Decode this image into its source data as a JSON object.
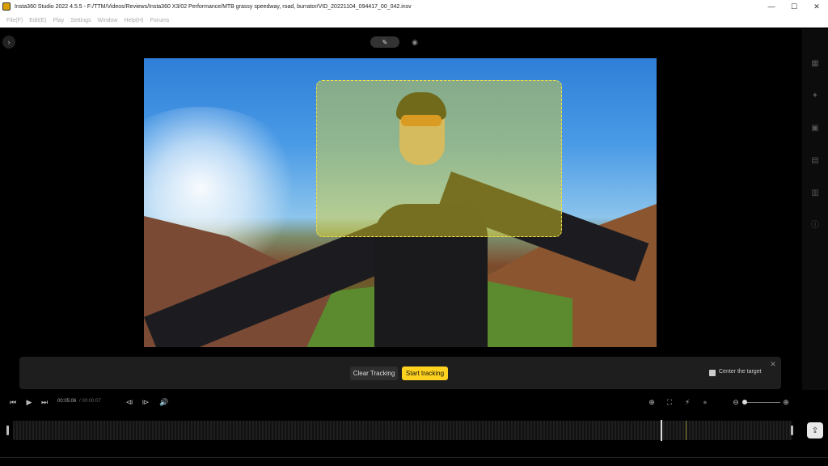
{
  "window": {
    "title": "Insta360 Studio 2022 4.5.5 - F:/TTM/Videos/Reviews/Insta360 X3/02 Performance/MTB grassy speedway, road, burrator/VID_20221104_094417_00_042.insv",
    "minimize": "—",
    "maximize": "☐",
    "close": "✕"
  },
  "menu": [
    "File(F)",
    "Edit(E)",
    "Play",
    "Settings",
    "Window",
    "Help(H)",
    "Forums"
  ],
  "viewer": {
    "expand_icon": "›",
    "edit_icon": "✎",
    "eye_icon": "◉"
  },
  "tracking": {
    "clear_label": "Clear Tracking",
    "start_label": "Start tracking",
    "center_label": "Center the target",
    "center_checked": false,
    "close_icon": "✕"
  },
  "playback": {
    "current_time": "00:05:06",
    "total_time": "/ 00:00:07",
    "prev": "⏮",
    "play": "▶",
    "next": "⏭",
    "mark_in": "⧏",
    "mark_out": "⧐",
    "volume": "🔊",
    "add_keyframe": "⊕",
    "screenshot": "⛶",
    "speed": "⚡",
    "marker": "●",
    "zoom_out": "⊖",
    "zoom_in": "⊕",
    "zoom_level": 0.05
  },
  "right_sidebar": [
    "▦",
    "✦",
    "▣",
    "▤",
    "▥",
    "ⓘ"
  ],
  "export_icon": "⇪"
}
